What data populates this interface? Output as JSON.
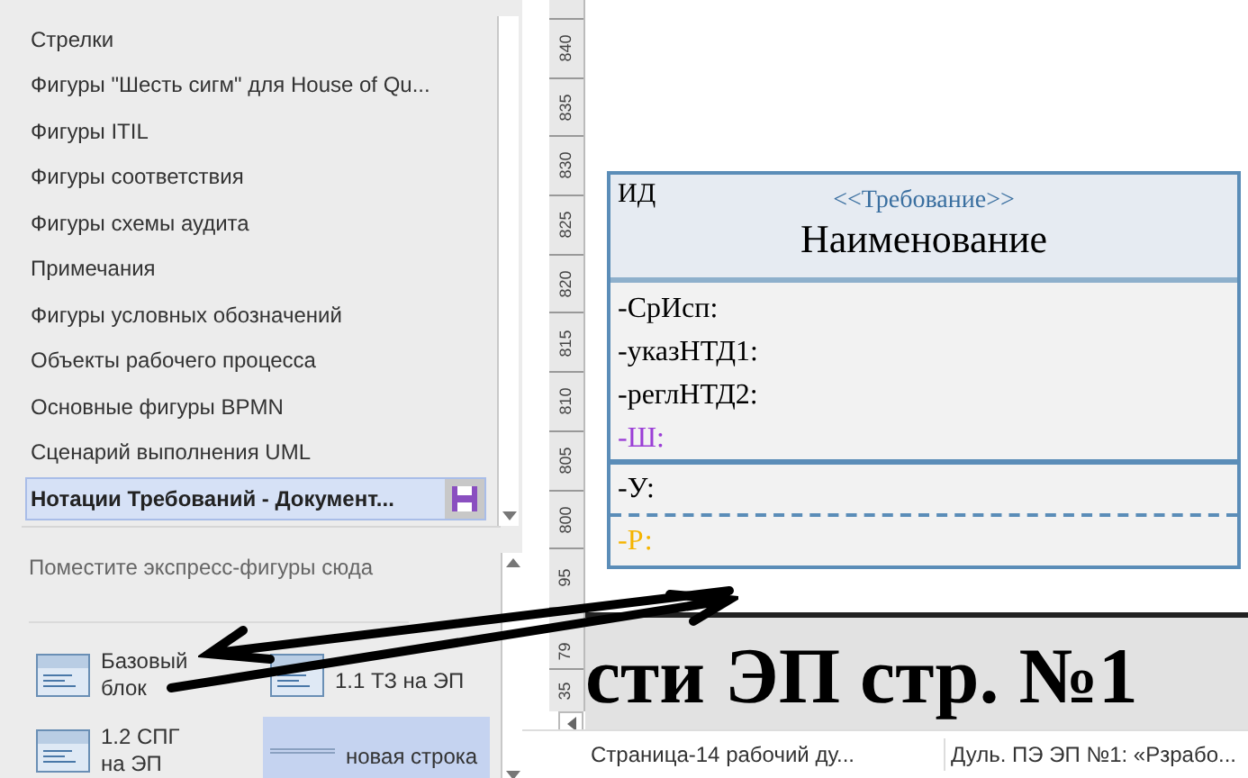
{
  "stencils": [
    {
      "label": "Стрелки",
      "selected": false
    },
    {
      "label": "Фигуры \"Шесть сигм\" для House of Qu...",
      "selected": false
    },
    {
      "label": "Фигуры ITIL",
      "selected": false
    },
    {
      "label": "Фигуры соответствия",
      "selected": false
    },
    {
      "label": "Фигуры схемы аудита",
      "selected": false
    },
    {
      "label": "Примечания",
      "selected": false
    },
    {
      "label": "Фигуры условных обозначений",
      "selected": false
    },
    {
      "label": "Объекты рабочего процесса",
      "selected": false
    },
    {
      "label": "Основные фигуры BPMN",
      "selected": false
    },
    {
      "label": "Сценарий выполнения UML",
      "selected": false
    },
    {
      "label": "Нотации Требований - Документ...",
      "selected": true
    }
  ],
  "quick_shapes": {
    "hint": "Поместите экспресс-фигуры сюда",
    "items": [
      {
        "label": "Базовый блок",
        "kind": "block",
        "selected": false
      },
      {
        "label": "1.1 ТЗ на ЭП",
        "kind": "block",
        "selected": false
      },
      {
        "label": "1.2 СПГ на ЭП",
        "kind": "block",
        "selected": false
      },
      {
        "label": "новая строка",
        "kind": "line",
        "selected": true
      }
    ]
  },
  "ruler": {
    "labels": [
      "840",
      "835",
      "830",
      "825",
      "820",
      "815",
      "810",
      "805",
      "800",
      "95"
    ],
    "lower_labels": [
      "79",
      "35"
    ]
  },
  "requirement": {
    "id": "ИД",
    "stereotype": "<<Требование>>",
    "name": "Наименование",
    "attributes": [
      {
        "text": "-СрИсп:",
        "color": "#000000"
      },
      {
        "text": "-указНТД1:",
        "color": "#000000"
      },
      {
        "text": "-реглНТД2:",
        "color": "#000000"
      },
      {
        "text": "-Ш:",
        "color": "#9b3fd6"
      }
    ],
    "operations": [
      {
        "text": "-У:",
        "color": "#000000"
      },
      {
        "text": "-Р:",
        "color": "#f5b400"
      }
    ]
  },
  "page_title": "сти ЭП стр. №1",
  "page_tabs": [
    {
      "label": "Страница-14 рабочий ду..."
    },
    {
      "label": "Дуль. ПЭ ЭП №1: «Рзрабо..."
    }
  ]
}
